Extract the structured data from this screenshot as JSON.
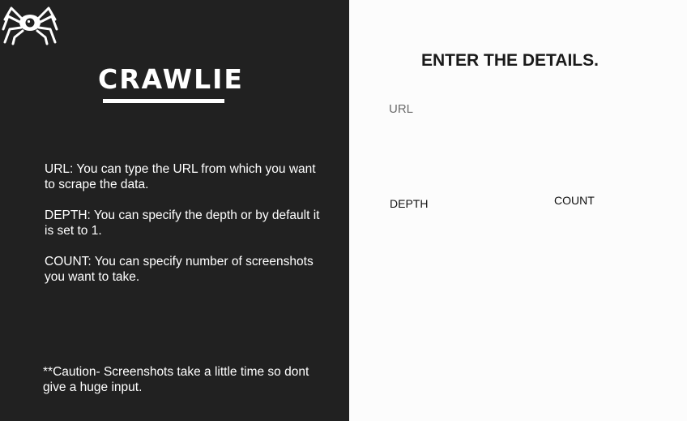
{
  "app": {
    "brand": "CRAWLIE",
    "logo_icon": "spider-icon"
  },
  "help": {
    "url": "URL: You can type the URL from which you want to scrape the data.",
    "depth": "DEPTH: You can specify the depth or by default it is set to 1.",
    "count": "COUNT: You can specify number of screenshots you want to take.",
    "caution": "**Caution- Screenshots take a little time so dont give a huge input."
  },
  "form": {
    "title": "ENTER THE DETAILS.",
    "url_label": "URL",
    "depth_label": "DEPTH",
    "count_label": "COUNT",
    "url_value": "",
    "depth_value": "",
    "count_value": ""
  },
  "colors": {
    "left_panel": "#212121",
    "right_panel": "#fcfcfc",
    "text_light": "#ffffff",
    "text_dark": "#1a1a1a"
  }
}
